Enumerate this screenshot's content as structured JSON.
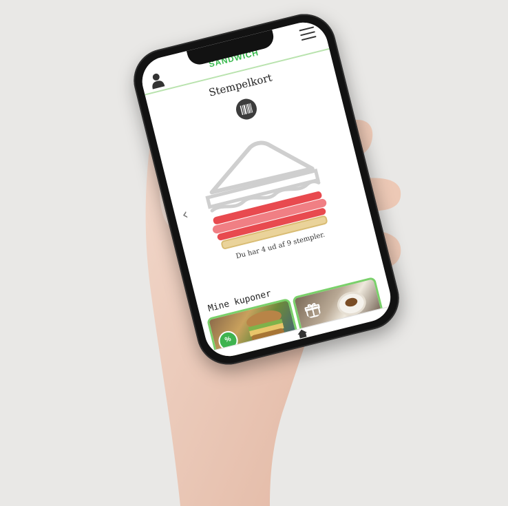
{
  "app": {
    "brand": "SANDWICH",
    "title": "Stempelkort",
    "stamp_text": "Du har 4 ud af 9 stempler.",
    "coupons_title": "Mine kuponer"
  },
  "stamps": {
    "collected": 4,
    "total": 9
  },
  "colors": {
    "accent": "#35b84a",
    "background": "#e9e8e6",
    "coupon_border": "#7ad06a",
    "stamp_filled": "#e84a4f",
    "stamp_empty": "#d0d0d0"
  },
  "icons": [
    "user-icon",
    "menu-icon",
    "barcode-icon",
    "chevron-left-icon",
    "discount-icon",
    "gift-icon",
    "home-icon"
  ]
}
